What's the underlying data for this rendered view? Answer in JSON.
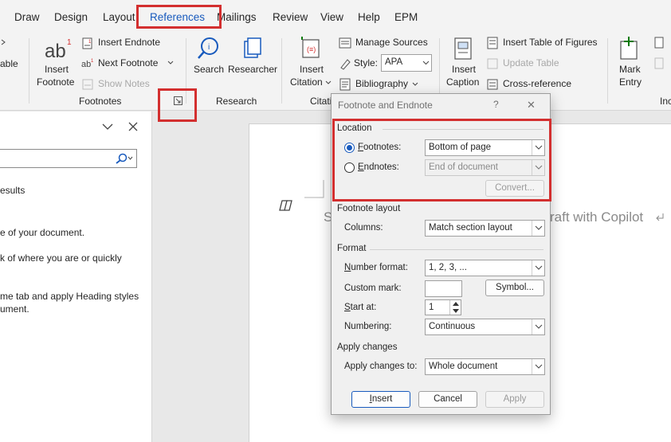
{
  "tabs": [
    "Draw",
    "Design",
    "Layout",
    "References",
    "Mailings",
    "Review",
    "View",
    "Help",
    "EPM"
  ],
  "active_tab": "References",
  "ribbon": {
    "left_clip": "able",
    "insert_footnote": [
      "Insert",
      "Footnote"
    ],
    "insert_endnote": "Insert Endnote",
    "next_footnote": "Next Footnote",
    "show_notes": "Show Notes",
    "footnotes_group": "Footnotes",
    "search": "Search",
    "researcher": "Researcher",
    "research_group": "Research",
    "insert_citation": [
      "Insert",
      "Citation"
    ],
    "manage_sources": "Manage Sources",
    "style_label": "Style:",
    "style_value": "APA",
    "bibliography": "Bibliography",
    "citations_group": "Citati",
    "insert_caption": [
      "Insert",
      "Caption"
    ],
    "insert_table_of_figures": "Insert Table of Figures",
    "update_table": "Update Table",
    "cross_reference": "Cross-reference",
    "mark_entry": [
      "Mark",
      "Entry"
    ],
    "index_group_clip": "Inc"
  },
  "nav_pane": {
    "search_icon": "search-icon",
    "lines": [
      "esults",
      "e of your document.",
      "k of where you are or quickly",
      "me tab and apply Heading styles",
      "ument."
    ]
  },
  "document": {
    "text_left": "S",
    "text_right": "raft with Copilot",
    "copilot_icon": "copilot-icon"
  },
  "dialog": {
    "title": "Footnote and Endnote",
    "help": "?",
    "close": "✕",
    "location": {
      "section": "Location",
      "footnotes_label": "Footnotes:",
      "footnotes_value": "Bottom of page",
      "endnotes_label": "Endnotes:",
      "endnotes_value": "End of document",
      "convert": "Convert..."
    },
    "footnote_layout": {
      "section": "Footnote layout",
      "columns_label": "Columns:",
      "columns_value": "Match section layout"
    },
    "format": {
      "section": "Format",
      "number_format_label": "Number format:",
      "number_format_value": "1, 2, 3, ...",
      "custom_mark_label": "Custom mark:",
      "custom_mark_value": "",
      "symbol": "Symbol...",
      "start_at_label": "Start at:",
      "start_at_value": "1",
      "numbering_label": "Numbering:",
      "numbering_value": "Continuous"
    },
    "apply_changes": {
      "section": "Apply changes",
      "apply_to_label": "Apply changes to:",
      "apply_to_value": "Whole document"
    },
    "buttons": {
      "insert": "Insert",
      "cancel": "Cancel",
      "apply": "Apply"
    }
  },
  "colors": {
    "accent": "#185abd",
    "highlight_red": "#d32f2f",
    "dialog_bg": "#f0f0f0",
    "ribbon_bg": "#f3f3f3"
  }
}
